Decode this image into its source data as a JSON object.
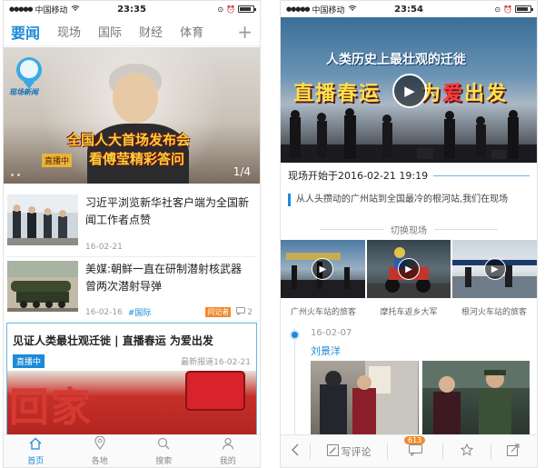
{
  "left": {
    "status": {
      "carrier": "中国移动",
      "time": "23:35"
    },
    "nav": {
      "tabs": [
        "要闻",
        "现场",
        "国际",
        "财经",
        "体育"
      ],
      "active": 0,
      "plus": "+"
    },
    "hero": {
      "logo_text": "现场新闻",
      "caption_line1": "全国人大首场发布会",
      "caption_line2": "看傅莹精彩答问",
      "live_badge": "直播中",
      "pager": "1/4"
    },
    "news": [
      {
        "title": "习近平浏览新华社客户端为全国新闻工作者点赞",
        "date": "16-02-21",
        "tag": "",
        "reporter": "",
        "comments": ""
      },
      {
        "title": "美媒:朝鲜一直在研制潜射核武器曾两次潜射导弹",
        "date": "16-02-16",
        "tag": "#国际",
        "reporter": "问记者",
        "comments": "2"
      }
    ],
    "live_card": {
      "title": "见证人类最壮观迁徙 | 直播春运 为爱出发",
      "badge": "直播中",
      "latest": "最新报道16-02-21",
      "image_text": "回家"
    },
    "bottom_tabs": [
      {
        "label": "首页",
        "icon": "home-icon"
      },
      {
        "label": "各地",
        "icon": "location-pin-icon"
      },
      {
        "label": "搜索",
        "icon": "search-icon"
      },
      {
        "label": "我的",
        "icon": "user-icon"
      }
    ]
  },
  "right": {
    "status": {
      "carrier": "中国移动",
      "time": "23:54"
    },
    "video": {
      "headline1": "人类历史上最壮观的迁徙",
      "headline2_a": "直播春运",
      "headline2_b": "为",
      "headline2_c": "爱",
      "headline2_d": "出发"
    },
    "start_label": "现场开始于2016-02-21 19:19",
    "description": "从人头攒动的广州站到全国最冷的根河站,我们在现场",
    "switch_label": "切换现场",
    "cams": [
      "广州火车站的旅客",
      "摩托车返乡大军",
      "根河火车站的旅客"
    ],
    "timeline": {
      "date": "16-02-07",
      "author": "刘景洋"
    },
    "bottom": {
      "comment_label": "写评论",
      "comment_count": "613"
    }
  },
  "colors": {
    "accent": "#1d8ad8",
    "orange": "#f08a2c"
  }
}
